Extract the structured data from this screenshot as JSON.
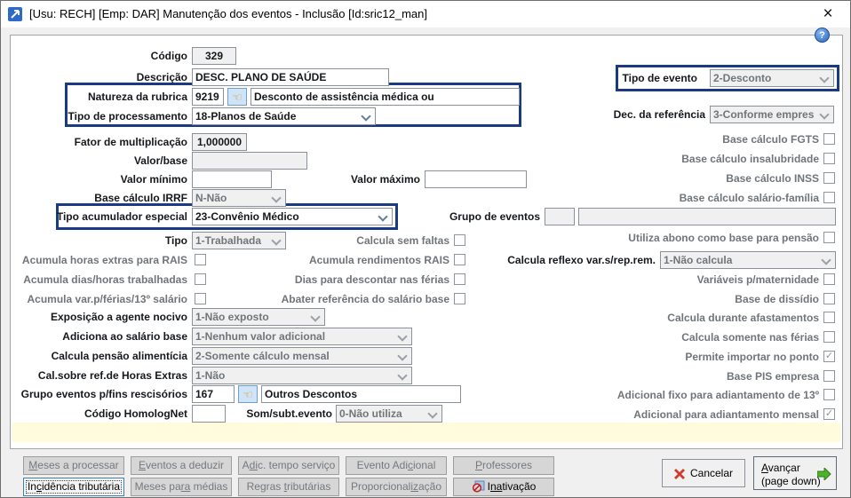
{
  "window": {
    "title": "[Usu: RECH] [Emp: DAR] Manutenção dos eventos - Inclusão [Id:sric12_man]",
    "close_glyph": "×",
    "help_glyph": "?"
  },
  "colors": {
    "highlight_border": "#1a3a82",
    "label_enabled": "#15181c",
    "label_disabled": "#70757a",
    "note_strip_bg": "#fffbdc",
    "panel_bg": "#ffffff",
    "dialog_bg": "#f0f0f0"
  },
  "icons": {
    "lookup_hand_glyph": "☜"
  },
  "fields": {
    "codigo": {
      "label": "Código",
      "value": "329"
    },
    "descricao": {
      "label": "Descrição",
      "value": "DESC. PLANO DE SAÚDE"
    },
    "natureza_rubrica": {
      "label": "Natureza da rubrica",
      "code": "9219",
      "description": "Desconto de assistência médica ou"
    },
    "tipo_processamento": {
      "label": "Tipo de processamento",
      "value": "18-Planos de Saúde"
    },
    "tipo_evento": {
      "label": "Tipo de evento",
      "value": "2-Desconto"
    },
    "dec_referencia": {
      "label": "Dec. da referência",
      "value": "3-Conforme empres"
    },
    "fator_multiplicacao": {
      "label": "Fator de multiplicação",
      "value": "1,000000"
    },
    "valor_base": {
      "label": "Valor/base",
      "value": ""
    },
    "valor_minimo": {
      "label": "Valor mínimo",
      "value": ""
    },
    "valor_maximo": {
      "label": "Valor máximo",
      "value": ""
    },
    "base_calculo_irrf": {
      "label": "Base cálculo IRRF",
      "value": "N-Não"
    },
    "tipo_acumulador": {
      "label": "Tipo acumulador especial",
      "value": "23-Convênio Médico"
    },
    "grupo_eventos": {
      "label": "Grupo de eventos",
      "code": "",
      "description": ""
    },
    "tipo": {
      "label": "Tipo",
      "value": "1-Trabalhada"
    },
    "calcula_reflexo": {
      "label": "Calcula reflexo var.s/rep.rem.",
      "value": "1-Não calcula"
    },
    "exposicao_agente": {
      "label": "Exposição a agente nocivo",
      "value": "1-Não exposto"
    },
    "adiciona_salario": {
      "label": "Adiciona ao salário base",
      "value": "1-Nenhum valor adicional"
    },
    "pensao_alimenticia": {
      "label": "Calcula pensão alimentícia",
      "value": "2-Somente cálculo mensal"
    },
    "cal_horas_extras": {
      "label": "Cal.sobre ref.de Horas Extras",
      "value": "1-Não"
    },
    "grupo_rescisorios": {
      "label": "Grupo eventos p/fins rescisórios",
      "code": "167",
      "description": "Outros Descontos"
    },
    "homolognet": {
      "label": "Código HomologNet",
      "value": ""
    },
    "som_subt": {
      "label": "Som/subt.evento",
      "value": "0-Não utiliza"
    }
  },
  "checkboxes": {
    "base_fgts": {
      "label": "Base cálculo FGTS",
      "checked": false
    },
    "base_insalubridade": {
      "label": "Base cálculo insalubridade",
      "checked": false
    },
    "base_inss": {
      "label": "Base cálculo INSS",
      "checked": false
    },
    "base_salario_familia": {
      "label": "Base cálculo salário-família",
      "checked": false
    },
    "calcula_sem_faltas": {
      "label": "Calcula sem faltas",
      "checked": false
    },
    "acumula_he_rais": {
      "label": "Acumula horas extras para RAIS",
      "checked": false
    },
    "acumula_rend_rais": {
      "label": "Acumula rendimentos RAIS",
      "checked": false
    },
    "utiliza_abono_pensao": {
      "label": "Utiliza abono como base para pensão",
      "checked": false
    },
    "acumula_dias_horas": {
      "label": "Acumula dias/horas trabalhadas",
      "checked": false
    },
    "dias_descontar_ferias": {
      "label": "Dias para descontar nas férias",
      "checked": false
    },
    "variaveis_maternidade": {
      "label": "Variáveis p/maternidade",
      "checked": false
    },
    "acumula_var_ferias_13": {
      "label": "Acumula var.p/férias/13º salário",
      "checked": false
    },
    "abater_ref_salario": {
      "label": "Abater referência do salário base",
      "checked": false
    },
    "base_dissidio": {
      "label": "Base de dissídio",
      "checked": false
    },
    "calcula_afastamentos": {
      "label": "Calcula durante afastamentos",
      "checked": false
    },
    "calcula_somente_ferias": {
      "label": "Calcula somente nas férias",
      "checked": false
    },
    "permite_importar_ponto": {
      "label": "Permite importar no ponto",
      "checked": true
    },
    "base_pis_empresa": {
      "label": "Base PIS empresa",
      "checked": false
    },
    "adicional_fixo_13": {
      "label": "Adicional fixo para adiantamento de 13º",
      "checked": false
    },
    "adicional_adiantamento_mensal": {
      "label": "Adicional para adiantamento mensal",
      "checked": true
    }
  },
  "tab_buttons": {
    "row1": {
      "meses_processar": {
        "pre": "",
        "u": "M",
        "post": "eses a processar"
      },
      "eventos_deduzir": {
        "pre": "",
        "u": "E",
        "post": "ventos a deduzir"
      },
      "adic_tempo": {
        "pre": "A",
        "u": "di",
        "post": "c. tempo serviço"
      },
      "evento_adicional": {
        "pre": "Evento Adi",
        "u": "c",
        "post": "ional"
      },
      "professores": {
        "pre": "",
        "u": "P",
        "post": "rofessores"
      }
    },
    "row2": {
      "incidencia": {
        "pre": "In",
        "u": "c",
        "post": "idência tributária"
      },
      "meses_medias": {
        "pre": "Meses pa",
        "u": "ra",
        "post": " médias"
      },
      "regras": {
        "pre": "Regras ",
        "u": "t",
        "post": "ributárias"
      },
      "proporcionalizacao": {
        "pre": "Proporcional",
        "u": "iz",
        "post": "ação"
      },
      "inativacao": {
        "pre": "I",
        "u": "na",
        "post": "tivação"
      }
    }
  },
  "action_buttons": {
    "cancelar": {
      "label": "Cancelar"
    },
    "avancar": {
      "u": "A",
      "line1": "vançar",
      "line2": "(page down)"
    }
  }
}
